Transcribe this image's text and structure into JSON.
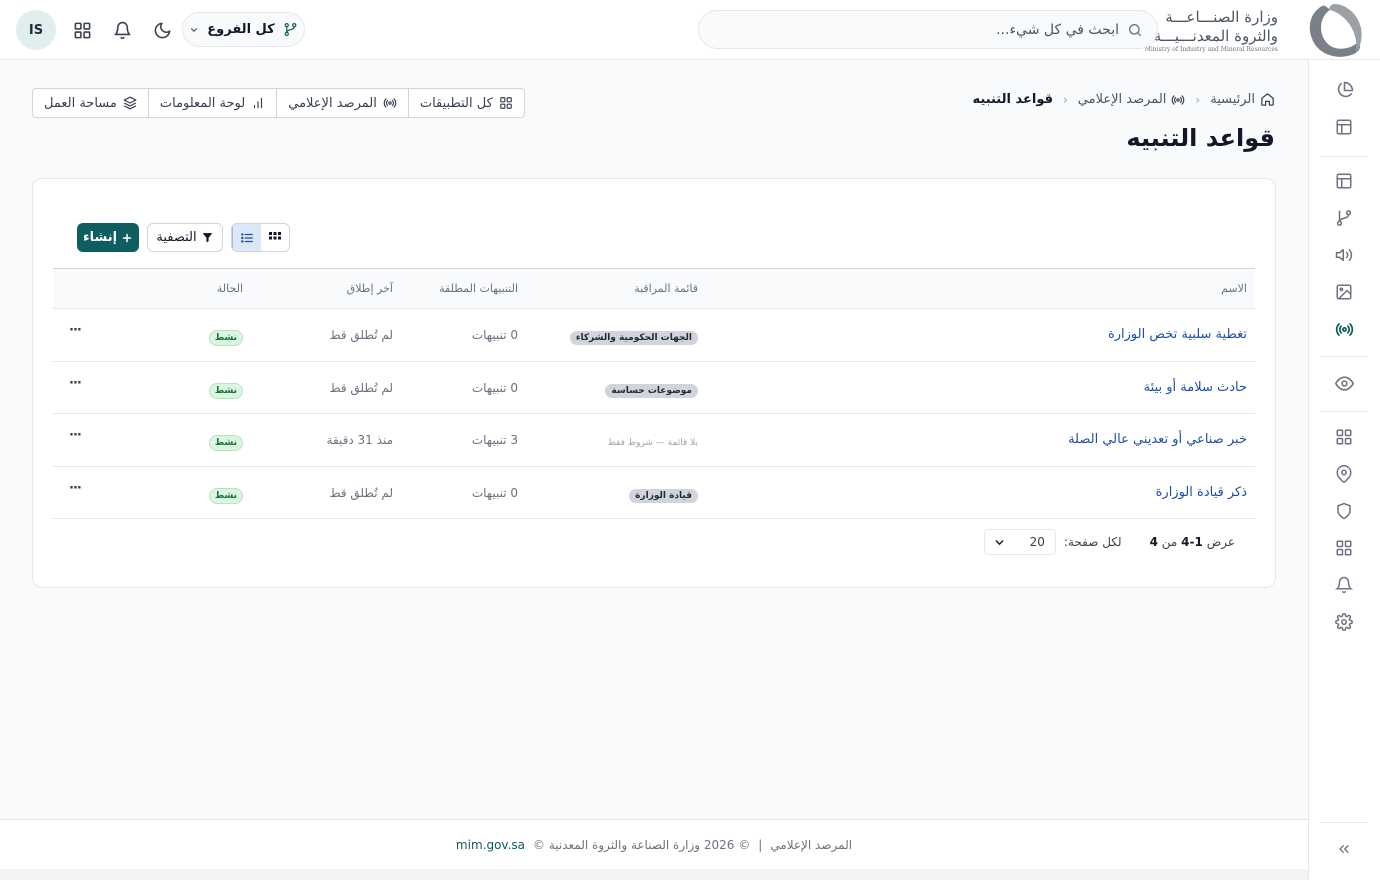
{
  "header": {
    "logo_text_ar_1": "وزارة الصنـــاعـــة",
    "logo_text_ar_2": "والثروة المعدنـــيـــة",
    "logo_text_en": "Ministry of Industry and Mineral Resources",
    "search_placeholder": "ابحث في كل شيء...",
    "branch_label": "كل الفروع",
    "avatar_initials": "IS"
  },
  "breadcrumb": {
    "home": "الرئيسية",
    "section": "المرصد الإعلامي",
    "current": "قواعد التنبيه"
  },
  "page_title": "قواعد التنبيه",
  "quicklinks": [
    {
      "label": "كل التطبيقات",
      "icon": "grid-icon"
    },
    {
      "label": "المرصد الإعلامي",
      "icon": "broadcast-icon"
    },
    {
      "label": "لوحة المعلومات",
      "icon": "bar-chart-icon"
    },
    {
      "label": "مساحة العمل",
      "icon": "layers-icon"
    }
  ],
  "toolbar": {
    "create_label": "إنشاء",
    "filter_label": "التصفية"
  },
  "table": {
    "columns": {
      "name": "الاسم",
      "watchlist": "قائمة المراقبة",
      "alerts": "التنبيهات المطلقة",
      "last": "آخر إطلاق",
      "status": "الحالة"
    },
    "rows": [
      {
        "name": "تغطية سلبية تخص الوزارة",
        "watchlist": "الجهات الحكومية والشركاء",
        "watchlist_is_chip": true,
        "alerts": "0 تنبيهات",
        "last": "لم تُطلق قط",
        "status": "نشط",
        "menu": "···"
      },
      {
        "name": "حادث سلامة أو بيئة",
        "watchlist": "موضوعات حساسة",
        "watchlist_is_chip": true,
        "alerts": "0 تنبيهات",
        "last": "لم تُطلق قط",
        "status": "نشط",
        "menu": "···"
      },
      {
        "name": "خبر صناعي أو تعديني عالي الصلة",
        "watchlist": "بلا قائمة — شروط فقط",
        "watchlist_is_chip": false,
        "alerts": "3 تنبيهات",
        "last": "منذ 31 دقيقة",
        "status": "نشط",
        "menu": "···"
      },
      {
        "name": "ذكر قيادة الوزارة",
        "watchlist": "قيادة الوزارة",
        "watchlist_is_chip": true,
        "alerts": "0 تنبيهات",
        "last": "لم تُطلق قط",
        "status": "نشط",
        "menu": "···"
      }
    ]
  },
  "pagination": {
    "showing_prefix": "عرض",
    "range": "1-4",
    "of_label": "من",
    "total": "4",
    "per_page_label": "لكل صفحة:",
    "per_page_value": "20"
  },
  "footer": {
    "app_name": "المرصد الإعلامي",
    "separator": "|",
    "copyright": "© 2026 وزارة الصناعة والثروة المعدنية ©",
    "domain": "mim.gov.sa"
  },
  "colors": {
    "primary": "#0f5e5f",
    "link": "#1e4fa8",
    "status_active_bg": "#dcf5e0",
    "status_active_text": "#16733a"
  }
}
